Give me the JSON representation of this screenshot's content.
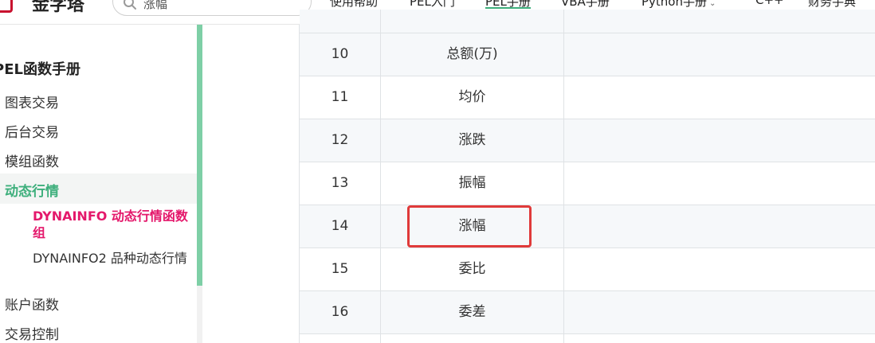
{
  "header": {
    "site_title": "金字塔",
    "search": {
      "value": "涨幅",
      "placeholder": "涨幅"
    },
    "nav": [
      {
        "label": "使用帮助"
      },
      {
        "label": "PEL入门"
      },
      {
        "label": "PEL手册",
        "active": true
      },
      {
        "label": "VBA手册"
      },
      {
        "label": "Python手册",
        "has_dropdown": true
      },
      {
        "label": "C++"
      },
      {
        "label": "财务手典"
      }
    ]
  },
  "sidebar": {
    "heading": "PEL函数手册",
    "items": [
      {
        "label": "图表交易"
      },
      {
        "label": "后台交易"
      },
      {
        "label": "模组函数"
      },
      {
        "label": "动态行情",
        "active": true
      },
      {
        "label": "账户函数"
      },
      {
        "label": "交易控制"
      }
    ],
    "subitems": [
      {
        "label": "DYNAINFO 动态行情函数组",
        "current": true
      },
      {
        "label": "DYNAINFO2 品种动态行情"
      }
    ]
  },
  "table": {
    "rows": [
      {
        "index": "10",
        "name": "总额(万)",
        "desc": ""
      },
      {
        "index": "11",
        "name": "均价",
        "desc": ""
      },
      {
        "index": "12",
        "name": "涨跌",
        "desc": ""
      },
      {
        "index": "13",
        "name": "振幅",
        "desc": ""
      },
      {
        "index": "14",
        "name": "涨幅",
        "desc": "",
        "highlighted": true
      },
      {
        "index": "15",
        "name": "委比",
        "desc": ""
      },
      {
        "index": "16",
        "name": "委差",
        "desc": ""
      }
    ]
  },
  "colors": {
    "accent": "#3eaf7c",
    "current_link": "#e4186b",
    "highlight_border": "#e03a3a",
    "logo_red": "#c8102e"
  }
}
